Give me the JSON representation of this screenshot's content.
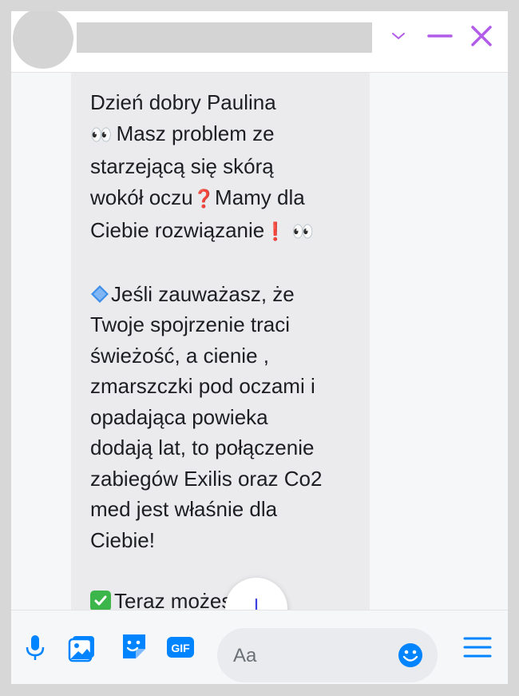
{
  "colors": {
    "accent": "#0084ff",
    "header_icon": "#b15ce8",
    "scroll_arrow": "#3b3fe0"
  },
  "header": {
    "icons": [
      "chevron-down-icon",
      "minimize-icon",
      "close-icon"
    ]
  },
  "message": {
    "lines_p1": [
      "Dzień dobry Paulina"
    ],
    "p1_l2_text": " Masz problem ze",
    "p1_l3": "starzejącą się skórą",
    "p1_l4_text": "wokół oczu",
    "p1_l4_emoji": "❓",
    "p1_l4_after": "Mamy dla",
    "p1_l5_text": "Ciebie rozwiązanie",
    "p1_l5_emoji": "❗",
    "eyes_emoji": "👀",
    "p2_l1_text": "Jeśli zauważasz, że",
    "p2_lines": [
      "Twoje spojrzenie traci",
      "świeżość, a cienie ,",
      "zmarszczki pod oczami i",
      "opadająca powieka",
      "dodają lat, to połączenie",
      "zabiegów Exilis oraz Co2",
      "med jest właśnie dla",
      "Ciebie!"
    ],
    "p3_l1_text": "Teraz możesz"
  },
  "composer": {
    "placeholder": "Aa",
    "icons": [
      "microphone-icon",
      "photo-icon",
      "sticker-icon",
      "gif-icon",
      "emoji-icon",
      "menu-icon"
    ]
  }
}
